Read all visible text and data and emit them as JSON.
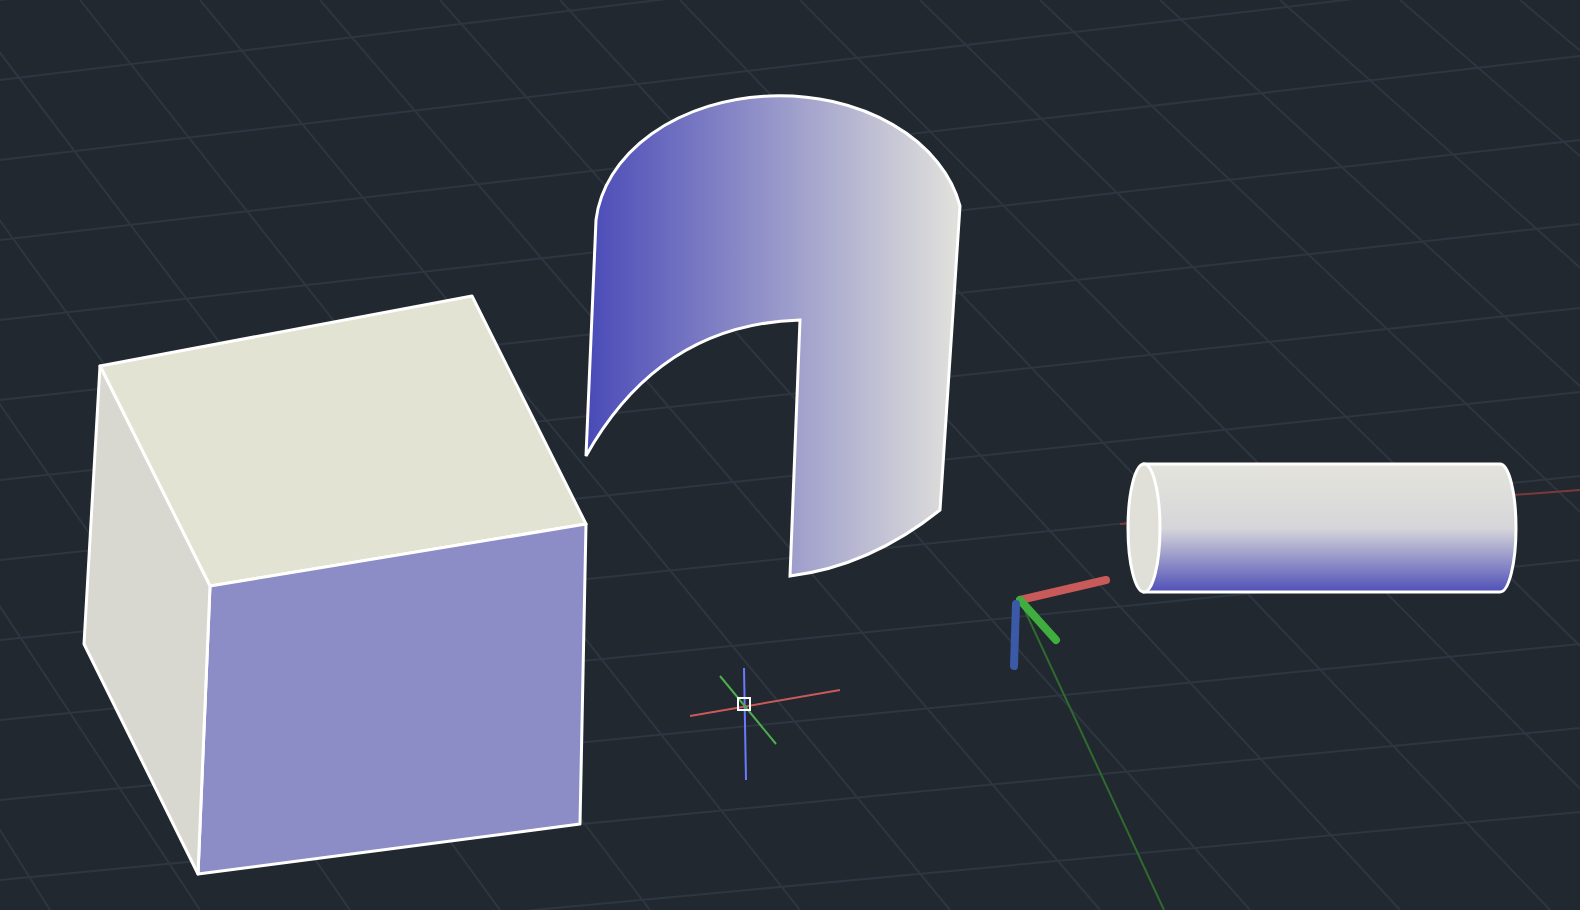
{
  "viewport": {
    "objects": [
      {
        "kind": "box"
      },
      {
        "kind": "half-cylinder"
      },
      {
        "kind": "cylinder"
      }
    ],
    "ucs_icon": true,
    "crosshair": true
  }
}
